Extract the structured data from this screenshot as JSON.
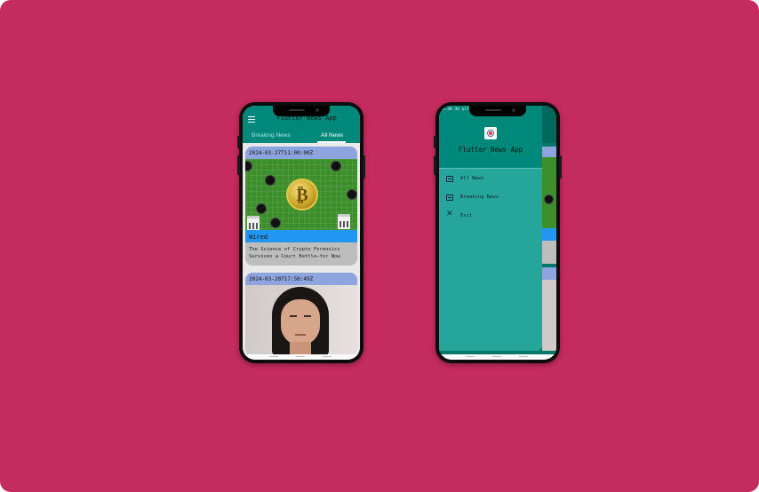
{
  "colors": {
    "background": "#c42b5e",
    "appbar": "#00897b",
    "drawer": "#26a69a",
    "date_strip": "#8ea4de",
    "source_strip": "#2196f3",
    "description_strip": "#bdbdbd"
  },
  "phone1": {
    "app_title": "Flutter News App",
    "menu_icon": "hamburger-icon",
    "tabs": [
      {
        "label": "Breaking News",
        "selected": false
      },
      {
        "label": "All News",
        "selected": true
      }
    ],
    "articles": [
      {
        "date": "2024-03-27T11:00:00Z",
        "image": "bitcoin-network-image",
        "source": "Wired",
        "description": "The Science of Crypto Forensics Survives a Court Battle—for Now"
      },
      {
        "date": "2024-03-20T17:50:49Z",
        "image": "portrait-photo-image"
      }
    ]
  },
  "phone2": {
    "status_text": "5:46 3G ull",
    "drawer_title": "Flutter News App",
    "logo_icon": "app-logo-icon",
    "menu": [
      {
        "label": "All News",
        "icon": "news-icon"
      },
      {
        "label": "Breaking News",
        "icon": "news-icon"
      },
      {
        "label": "Exit",
        "icon": "close-icon"
      }
    ]
  }
}
